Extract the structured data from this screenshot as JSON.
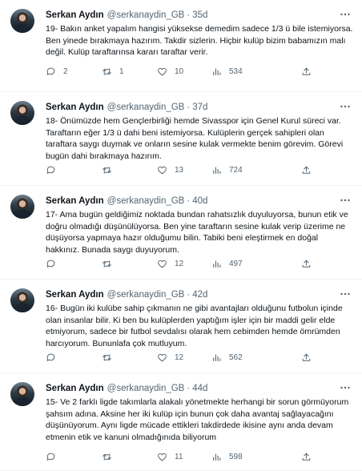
{
  "author": {
    "name": "Serkan Aydın",
    "handle": "@serkanaydin_GB"
  },
  "separator": "·",
  "tweets": [
    {
      "time": "35d",
      "text": "19- Bakın anket yapalım hangisi yüksekse demedim sadece 1/3 ü bile istemiyorsa. Ben yinede bırakmaya hazırım. Takdir sizlerin. Hiçbir kulüp bizim babamızın malı değil. Kulüp taraftarınsa kararı taraftar verir.",
      "replies": "2",
      "retweets": "1",
      "likes": "10",
      "views": "534"
    },
    {
      "time": "37d",
      "text": "18- Önümüzde hem Gençlerbirliği hemde Sivasspor için Genel Kurul süreci var. Taraftarın eğer 1/3 ü dahi beni istemiyorsa. Kulüplerin gerçek sahipleri olan taraftara saygı duymak ve onların sesine kulak vermekte benim görevim. Görevi bugün dahi bırakmaya hazırım.",
      "replies": "",
      "retweets": "",
      "likes": "13",
      "views": "724"
    },
    {
      "time": "40d",
      "text": "17- Ama bugün geldiğimiz noktada bundan rahatsızlık duyuluyorsa, bunun etik ve doğru olmadığı düşünülüyorsa. Ben yine taraftarın sesine kulak verip üzerime ne düşüyorsa yapmaya hazır olduğumu bilin. Tabiki beni eleştirmek en doğal hakkınız. Bunada saygı duyuyorum.",
      "replies": "",
      "retweets": "",
      "likes": "12",
      "views": "497"
    },
    {
      "time": "42d",
      "text": "16- Bugün iki kulübe sahip çıkmanın ne gibi avantajları olduğunu futbolun içinde olan insanlar bilir. Ki ben bu kulüplerden yaptığım işler için bir maddi gelir elde etmiyorum, sadece bir futbol sevdalısı olarak hem cebimden hemde ömrümden harcıyorum. Bununlafa çok mutluyum.",
      "replies": "",
      "retweets": "",
      "likes": "12",
      "views": "562"
    },
    {
      "time": "44d",
      "text": "15- Ve 2 farklı ligde takımlarla alakalı yönetmekte herhangi bir sorun görmüyorum şahsım adına. Aksine her iki kulüp için bunun çok daha avantaj sağlayacağını düşünüyorum. Aynı ligde mücade ettikleri takdirdede ikisine aynı anda devam etmenin etik ve kanuni olmadığınıda biliyorum",
      "replies": "",
      "retweets": "",
      "likes": "11",
      "views": "598"
    }
  ]
}
